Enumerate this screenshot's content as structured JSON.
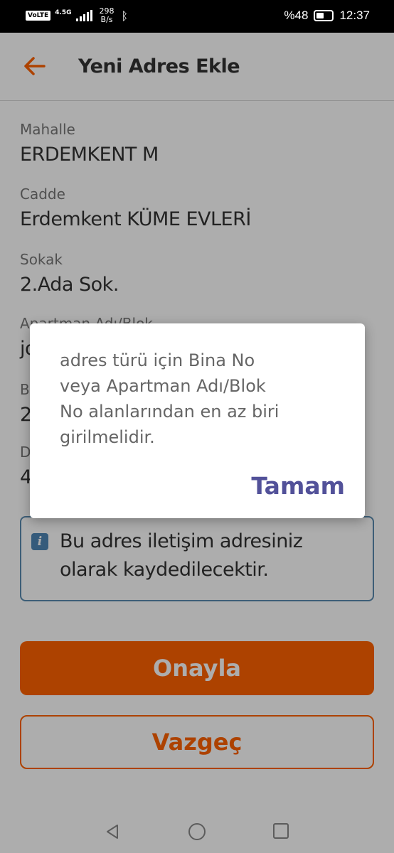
{
  "status_bar": {
    "volte": "VoLTE",
    "network": "4.5G",
    "speed_value": "298",
    "speed_unit": "B/s",
    "battery_text": "%48",
    "battery_level": 0.48,
    "time": "12:37"
  },
  "header": {
    "title": "Yeni Adres Ekle"
  },
  "form": {
    "fields": [
      {
        "label": "Mahalle",
        "value": "ERDEMKENT M"
      },
      {
        "label": "Cadde",
        "value": "Erdemkent KÜME EVLERİ"
      },
      {
        "label": "Sokak",
        "value": "2.Ada Sok."
      },
      {
        "label": "Apartman Adı/Blok",
        "value": "jo"
      },
      {
        "label": "B",
        "value": "2"
      },
      {
        "label": "D",
        "value": "4"
      }
    ]
  },
  "info": {
    "text": "Bu adres iletişim adresiniz olarak kaydedilecektir."
  },
  "buttons": {
    "confirm": "Onayla",
    "cancel": "Vazgeç"
  },
  "dialog": {
    "message": " adres türü için Bina No\nveya Apartman Adı/Blok\nNo alanlarından en az biri\ngirilmelidir.",
    "ok_label": "Tamam"
  },
  "colors": {
    "brand_orange": "#ff6200",
    "dialog_button": "#525199",
    "info_border": "#5a8bb0"
  }
}
